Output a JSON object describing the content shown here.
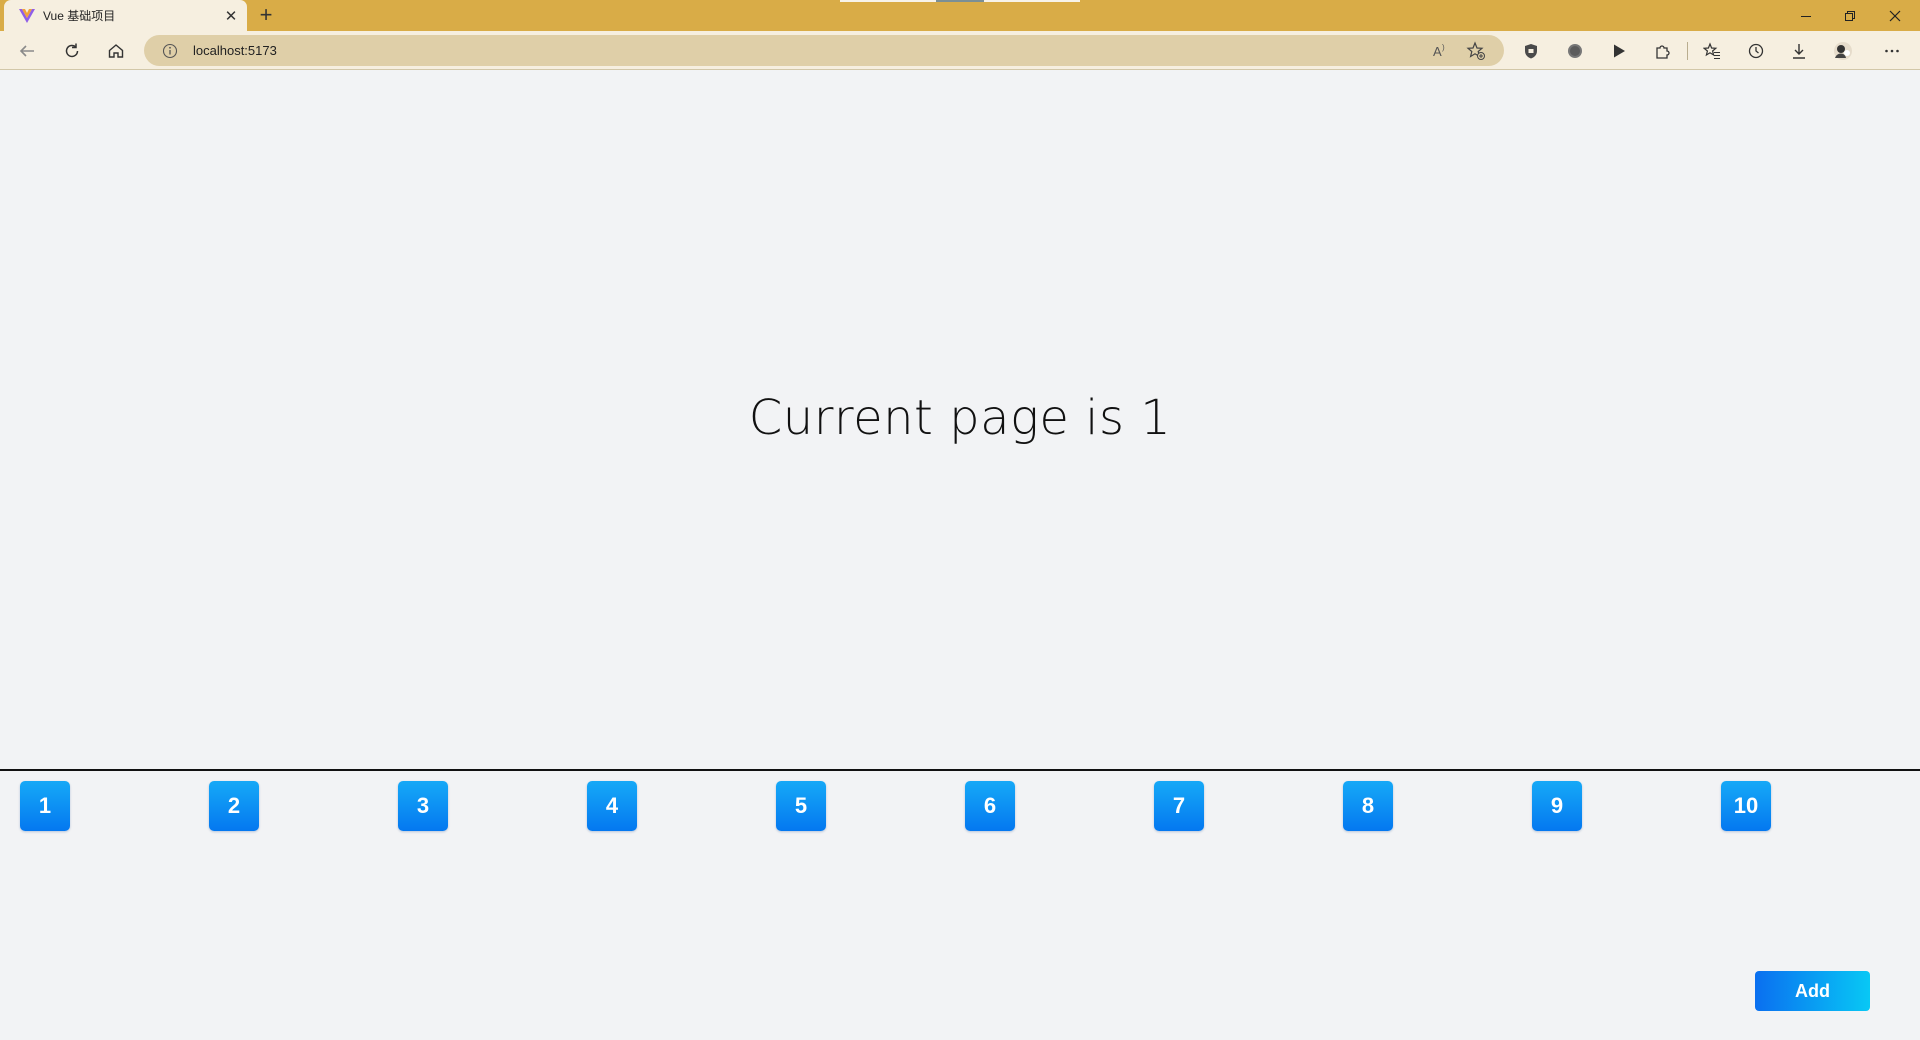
{
  "browser": {
    "tab": {
      "title": "Vue 基础项目",
      "favicon": "vue-logo-icon",
      "close_glyph": "✕"
    },
    "new_tab_glyph": "+",
    "address": {
      "url": "localhost:5173"
    },
    "toolbar_icons": [
      "back-arrow-icon",
      "refresh-icon",
      "home-icon",
      "info-icon",
      "read-aloud-icon",
      "add-favorite-icon",
      "shield-extension-icon",
      "circle-extension-icon",
      "play-extension-icon",
      "extensions-puzzle-icon",
      "favorites-star-icon",
      "history-icon",
      "download-icon",
      "profile-avatar-icon",
      "more-menu-icon"
    ],
    "window_controls": [
      "minimize-icon",
      "restore-icon",
      "close-icon"
    ],
    "colors": {
      "titlebar": "#d9ac47",
      "toolbar": "#f6efe0",
      "address_bar": "#dfcfa8"
    }
  },
  "page": {
    "heading": "Current page is 1",
    "pages": [
      {
        "label": "1"
      },
      {
        "label": "2"
      },
      {
        "label": "3"
      },
      {
        "label": "4"
      },
      {
        "label": "5"
      },
      {
        "label": "6"
      },
      {
        "label": "7"
      },
      {
        "label": "8"
      },
      {
        "label": "9"
      },
      {
        "label": "10"
      }
    ],
    "add_label": "Add",
    "colors": {
      "background": "#f2f3f5",
      "button_top": "#16a9f7",
      "button_bottom": "#0478f0",
      "add_left": "#0a6ff0",
      "add_right": "#08c8f5"
    }
  }
}
